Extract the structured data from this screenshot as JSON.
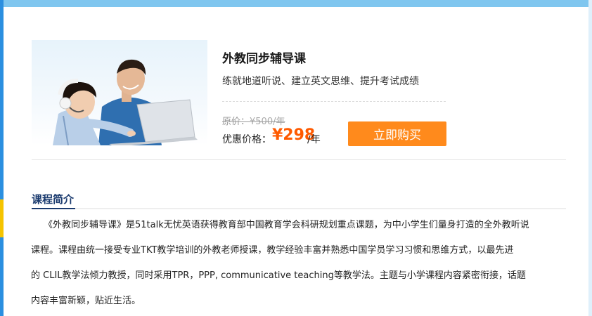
{
  "course": {
    "title": "外教同步辅导课",
    "subtitle": "练就地道听说、建立英文思维、提升考试成绩",
    "original_price_label": "原价：",
    "original_price_value": "¥500/年",
    "sale_label": "优惠价格：",
    "sale_price": "¥298",
    "sale_unit": "/年",
    "buy_label": "立即购买",
    "image_icon": "teacher-and-child-at-laptop-photo"
  },
  "intro": {
    "heading": "课程简介",
    "lines": [
      "《外教同步辅导课》是51talk无忧英语获得教育部中国教育学会科研规划重点课题，为中小学生们量身打造的全外教听说",
      "课程。课程由统一接受专业TKT教学培训的外教老师授课，教学经验丰富并熟悉中国学员学习习惯和思维方式，以最先进",
      "的 CLIL教学法倾力教授，同时采用TPR，PPP, communicative teaching等教学法。主题与小学课程内容紧密衔接，话题",
      "内容丰富新颖，贴近生活。"
    ]
  },
  "colors": {
    "accent_orange": "#ff8a1c",
    "price_orange": "#ff5a00",
    "heading_navy": "#1a3a6e",
    "band_blue": "#7fc6ef"
  }
}
